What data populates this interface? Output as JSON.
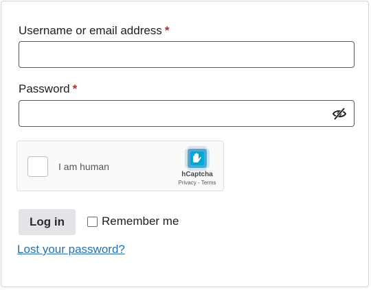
{
  "form": {
    "username_label": "Username or email address",
    "username_required": "*",
    "username_value": "",
    "password_label": "Password",
    "password_required": "*",
    "password_value": ""
  },
  "captcha": {
    "checkbox_checked": false,
    "label": "I am human",
    "brand": "hCaptcha",
    "privacy_link": "Privacy",
    "separator": " - ",
    "terms_link": "Terms"
  },
  "actions": {
    "login_label": "Log in",
    "remember_label": "Remember me",
    "remember_checked": false,
    "lost_password_link": "Lost your password?"
  },
  "colors": {
    "required_asterisk": "#b32d2e",
    "link": "#2271b1",
    "button_bg": "#e4e4e8"
  },
  "icons": {
    "password_toggle": "eye-slash-icon",
    "captcha_logo": "hcaptcha-logo-icon"
  }
}
